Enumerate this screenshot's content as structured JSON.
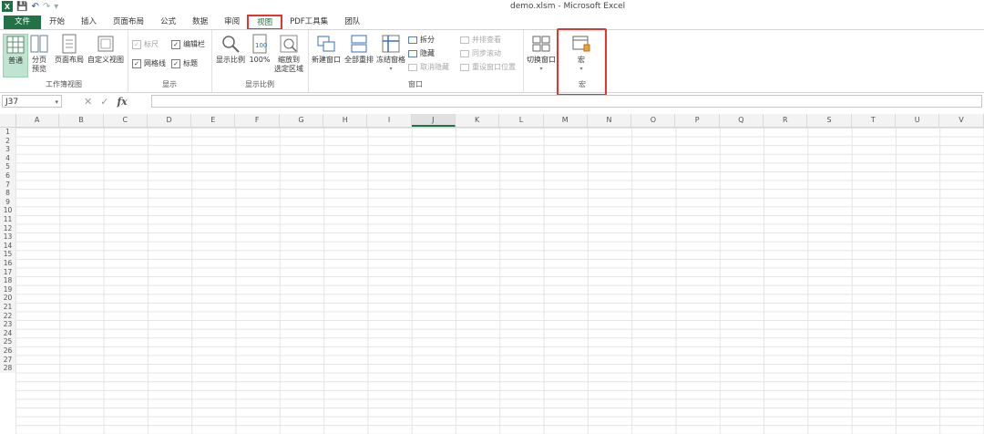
{
  "window": {
    "title": "demo.xlsm - Microsoft Excel"
  },
  "qat": {
    "logo": "X"
  },
  "tabs": [
    "文件",
    "开始",
    "插入",
    "页面布局",
    "公式",
    "数据",
    "审阅",
    "视图",
    "PDF工具集",
    "团队"
  ],
  "active_tab": "视图",
  "ribbon": {
    "workbook_views": {
      "label": "工作簿视图",
      "normal": "普通",
      "page_break": "分页\n预览",
      "page_layout": "页面布局",
      "custom": "自定义视图"
    },
    "show": {
      "label": "显示",
      "ruler": "标尺",
      "formula_bar": "编辑栏",
      "gridlines": "网格线",
      "headings": "标题"
    },
    "zoom": {
      "label": "显示比例",
      "zoom": "显示比例",
      "hundred": "100%",
      "to_selection": "缩放到\n选定区域"
    },
    "window": {
      "label": "窗口",
      "new_window": "新建窗口",
      "arrange_all": "全部重排",
      "freeze": "冻结窗格",
      "split": "拆分",
      "hide": "隐藏",
      "unhide": "取消隐藏",
      "side_by_side": "并排查看",
      "sync_scroll": "同步滚动",
      "reset_pos": "重设窗口位置",
      "switch": "切换窗口"
    },
    "macros": {
      "label": "宏",
      "macros": "宏"
    }
  },
  "formula_bar": {
    "name_box": "J37",
    "fx": "fx",
    "value": ""
  },
  "grid": {
    "columns": [
      "A",
      "B",
      "C",
      "D",
      "E",
      "F",
      "G",
      "H",
      "I",
      "J",
      "K",
      "L",
      "M",
      "N",
      "O",
      "P",
      "Q",
      "R",
      "S",
      "T",
      "U",
      "V"
    ],
    "selected_column": "J",
    "rows": [
      "1",
      "2",
      "3",
      "4",
      "5",
      "6",
      "7",
      "8",
      "9",
      "10",
      "11",
      "12",
      "13",
      "14",
      "15",
      "16",
      "17",
      "18",
      "19",
      "20",
      "21",
      "22",
      "23",
      "24",
      "25",
      "26",
      "27",
      "28"
    ]
  },
  "colors": {
    "accent": "#217346",
    "highlight": "#e8322c"
  }
}
